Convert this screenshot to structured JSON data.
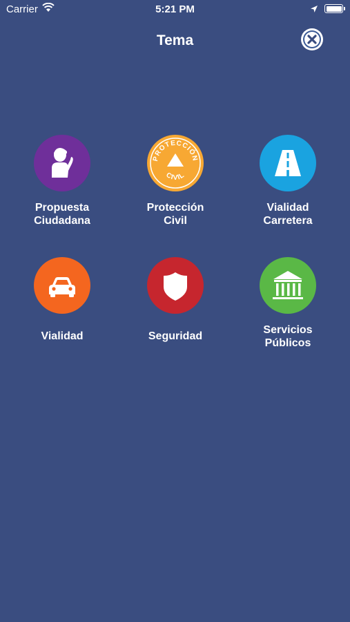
{
  "status_bar": {
    "carrier": "Carrier",
    "time": "5:21 PM",
    "icons": [
      "wifi-icon",
      "location-arrow-icon",
      "battery-icon"
    ]
  },
  "header": {
    "title": "Tema",
    "close_icon": "close-icon"
  },
  "topics": [
    {
      "label": "Propuesta\nCiudadana",
      "icon": "citizen-person-icon",
      "color": "#6f2f9a"
    },
    {
      "label": "Protección\nCivil",
      "icon": "civil-protection-logo-icon",
      "color": "#f7a833",
      "logo_text_top": "PROTECCIÓN",
      "logo_text_bottom": "CIVIL"
    },
    {
      "label": "Vialidad\nCarretera",
      "icon": "road-icon",
      "color": "#1aa3e0"
    },
    {
      "label": "Vialidad",
      "icon": "car-icon",
      "color": "#f4661f"
    },
    {
      "label": "Seguridad",
      "icon": "shield-icon",
      "color": "#c6262e"
    },
    {
      "label": "Servicios\nPúblicos",
      "icon": "public-building-icon",
      "color": "#5ab846"
    }
  ]
}
